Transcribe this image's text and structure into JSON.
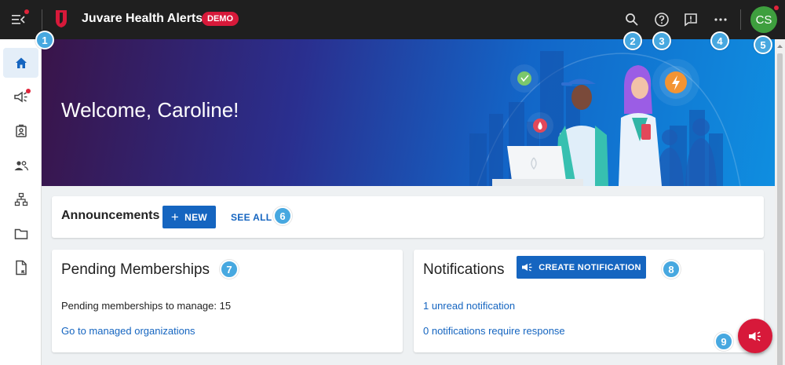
{
  "header": {
    "app_title": "Juvare Health Alerts",
    "badge": "DEMO",
    "avatar_initials": "CS",
    "icons": [
      "menu-collapse-icon",
      "juvare-logo",
      "search-icon",
      "help-icon",
      "feedback-icon",
      "more-icon"
    ]
  },
  "sidebar": {
    "items": [
      {
        "icon": "home-icon",
        "active": true
      },
      {
        "icon": "megaphone-icon",
        "notification_dot": true
      },
      {
        "icon": "contact-card-icon"
      },
      {
        "icon": "people-icon"
      },
      {
        "icon": "org-hierarchy-icon"
      },
      {
        "icon": "folder-icon"
      },
      {
        "icon": "document-report-icon"
      }
    ]
  },
  "hero": {
    "welcome": "Welcome, Caroline!"
  },
  "announcements": {
    "title": "Announcements",
    "new_label": "NEW",
    "see_all_label": "SEE ALL"
  },
  "pending": {
    "title": "Pending Memberships",
    "summary": "Pending memberships to manage: 15",
    "link": "Go to managed organizations"
  },
  "notifications": {
    "title": "Notifications",
    "create_label": "CREATE NOTIFICATION",
    "unread_link": "1 unread notification",
    "response_link": "0 notifications require response"
  },
  "callouts": [
    "1",
    "2",
    "3",
    "4",
    "5",
    "6",
    "7",
    "8",
    "9"
  ],
  "colors": {
    "topbar": "#1f1f1f",
    "primary": "#1565c0",
    "brand_red": "#d7193a",
    "callout": "#47a8e0",
    "avatar": "#3e9f3e"
  }
}
